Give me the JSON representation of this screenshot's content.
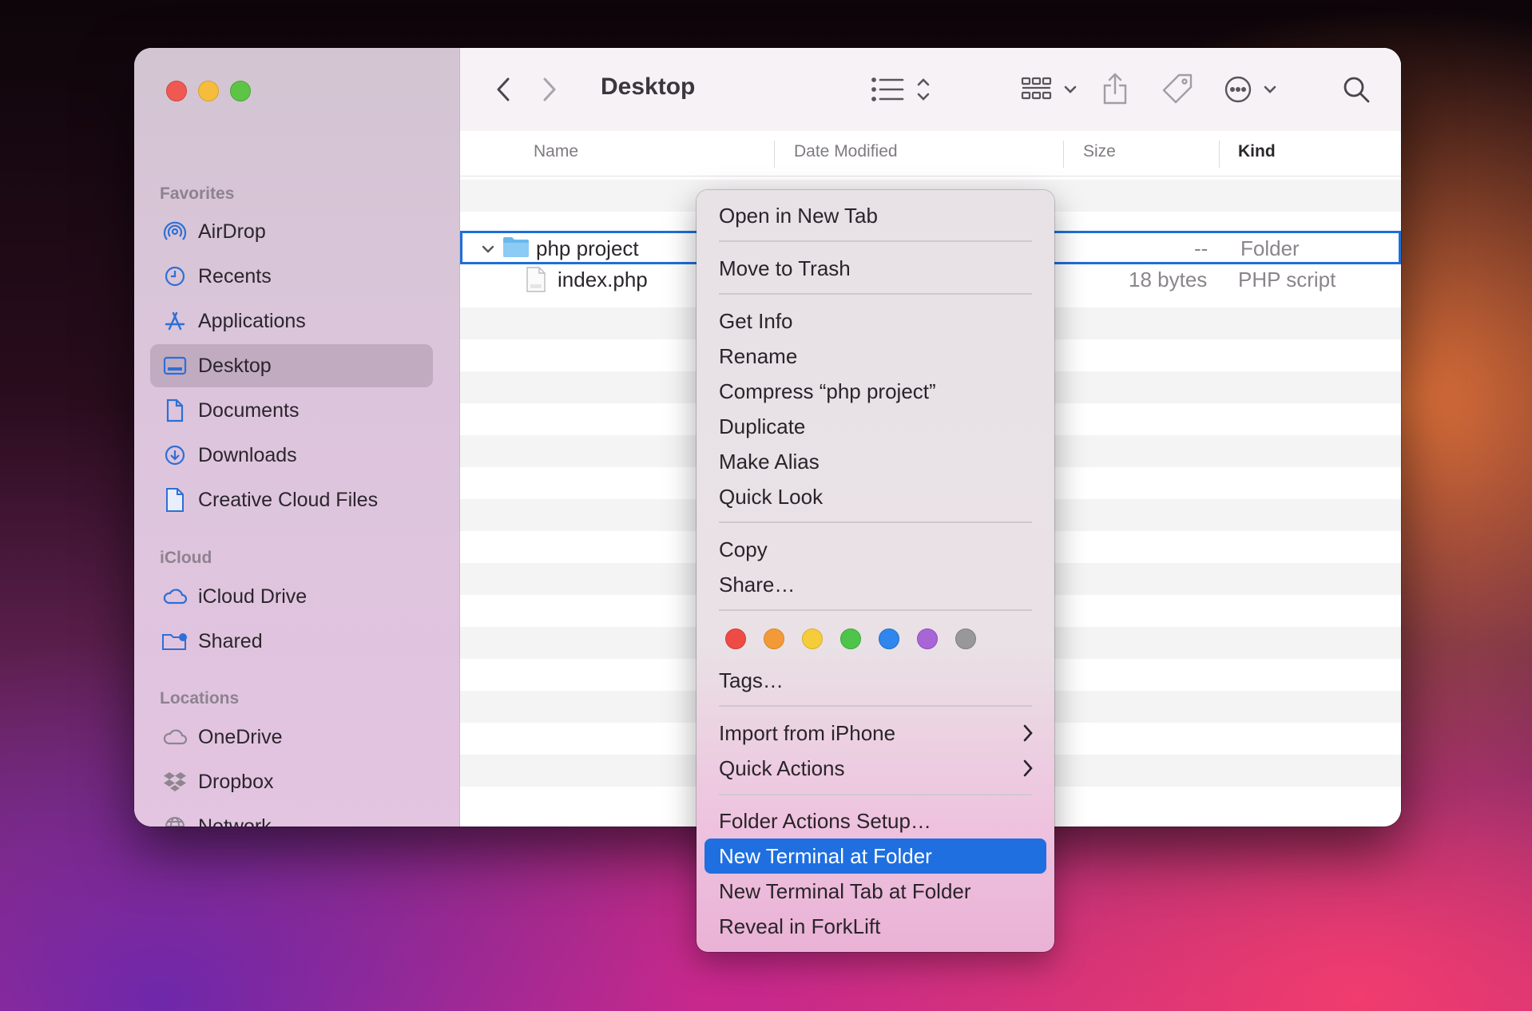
{
  "window": {
    "title": "Desktop",
    "traffic_lights": [
      "close",
      "minimize",
      "zoom"
    ]
  },
  "sidebar": {
    "favorites_header": "Favorites",
    "favorites": [
      {
        "label": "AirDrop",
        "icon": "airdrop-icon"
      },
      {
        "label": "Recents",
        "icon": "clock-icon"
      },
      {
        "label": "Applications",
        "icon": "applications-icon"
      },
      {
        "label": "Desktop",
        "icon": "desktop-icon",
        "selected": true
      },
      {
        "label": "Documents",
        "icon": "document-icon"
      },
      {
        "label": "Downloads",
        "icon": "download-icon"
      },
      {
        "label": "Creative Cloud Files",
        "icon": "file-icon"
      }
    ],
    "icloud_header": "iCloud",
    "icloud": [
      {
        "label": "iCloud Drive",
        "icon": "cloud-icon"
      },
      {
        "label": "Shared",
        "icon": "shared-folder-icon"
      }
    ],
    "locations_header": "Locations",
    "locations": [
      {
        "label": "OneDrive",
        "icon": "cloud-icon"
      },
      {
        "label": "Dropbox",
        "icon": "dropbox-icon"
      },
      {
        "label": "Network",
        "icon": "globe-icon"
      }
    ]
  },
  "columns": {
    "name": "Name",
    "date_modified": "Date Modified",
    "size": "Size",
    "kind": "Kind"
  },
  "files": [
    {
      "name": "php project",
      "size": "--",
      "kind": "Folder",
      "expanded": true,
      "selected": true
    },
    {
      "name": "index.php",
      "size": "18 bytes",
      "kind": "PHP script"
    }
  ],
  "context_menu": {
    "open_new_tab": "Open in New Tab",
    "move_to_trash": "Move to Trash",
    "get_info": "Get Info",
    "rename": "Rename",
    "compress": "Compress “php project”",
    "duplicate": "Duplicate",
    "make_alias": "Make Alias",
    "quick_look": "Quick Look",
    "copy": "Copy",
    "share": "Share…",
    "tag_colors": [
      "#ee4b45",
      "#f39a38",
      "#f5cc3a",
      "#4fc44a",
      "#2f86ec",
      "#a865d6",
      "#98979a"
    ],
    "tags": "Tags…",
    "import_iphone": "Import from iPhone",
    "quick_actions": "Quick Actions",
    "folder_actions": "Folder Actions Setup…",
    "new_terminal": "New Terminal at Folder",
    "new_terminal_tab": "New Terminal Tab at Folder",
    "reveal_forklift": "Reveal in ForkLift"
  },
  "colors": {
    "accent": "#1f6fe0",
    "sidebar_icon": "#2d6fd6"
  }
}
